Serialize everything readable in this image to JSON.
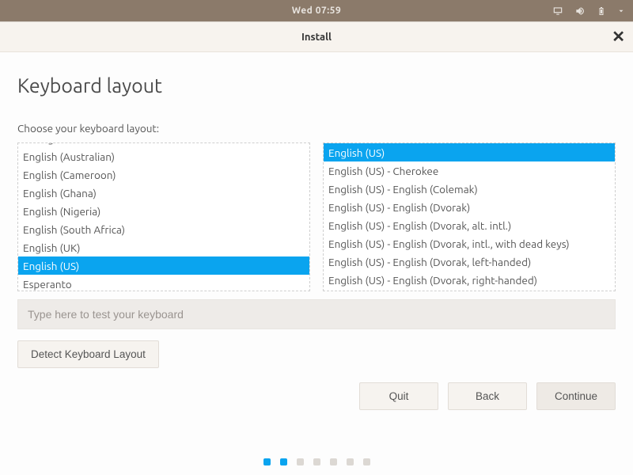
{
  "topbar": {
    "clock": "Wed 07:59"
  },
  "window": {
    "title": "Install",
    "close_glyph": "✕"
  },
  "page": {
    "title": "Keyboard layout",
    "prompt": "Choose your keyboard layout:"
  },
  "layouts": {
    "items": [
      "Dzongkha",
      "English (Australian)",
      "English (Cameroon)",
      "English (Ghana)",
      "English (Nigeria)",
      "English (South Africa)",
      "English (UK)",
      "English (US)",
      "Esperanto"
    ],
    "selected_index": 7
  },
  "variants": {
    "items": [
      "English (US)",
      "English (US) - Cherokee",
      "English (US) - English (Colemak)",
      "English (US) - English (Dvorak)",
      "English (US) - English (Dvorak, alt. intl.)",
      "English (US) - English (Dvorak, intl., with dead keys)",
      "English (US) - English (Dvorak, left-handed)",
      "English (US) - English (Dvorak, right-handed)"
    ],
    "selected_index": 0
  },
  "test_input": {
    "placeholder": "Type here to test your keyboard",
    "value": ""
  },
  "buttons": {
    "detect": "Detect Keyboard Layout",
    "quit": "Quit",
    "back": "Back",
    "continue": "Continue"
  },
  "stepper": {
    "total": 7,
    "active_count": 2
  }
}
